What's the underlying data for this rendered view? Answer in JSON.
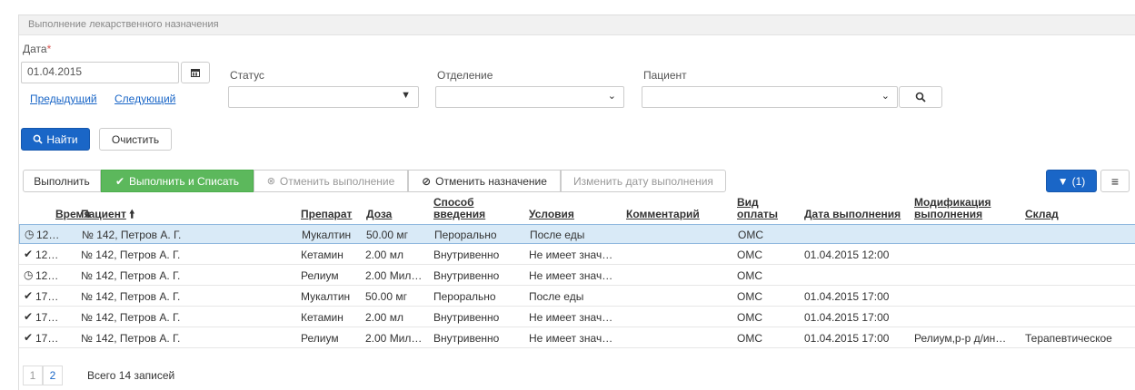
{
  "panel": {
    "title": "Выполнение лекарственного назначения"
  },
  "filters": {
    "date_label": "Дата",
    "date_required": "*",
    "date_value": "01.04.2015",
    "prev_link": "Предыдущий",
    "next_link": "Следующий",
    "status_label": "Статус",
    "status_value": "",
    "department_label": "Отделение",
    "department_value": "",
    "patient_label": "Пациент",
    "patient_value": ""
  },
  "actions": {
    "find": "Найти",
    "clear": "Очистить"
  },
  "toolbar": {
    "execute": "Выполнить",
    "execute_writeoff": "Выполнить и Списать",
    "cancel_execution": "Отменить выполнение",
    "cancel_prescription": "Отменить назначение",
    "change_date": "Изменить дату выполнения",
    "filter_count": "(1)"
  },
  "table": {
    "headers": {
      "time": "Время",
      "patient": "Пациент",
      "drug": "Препарат",
      "dose": "Доза",
      "route_1": "Способ",
      "route_2": "введения",
      "conditions": "Условия",
      "comment": "Комментарий",
      "payment_1": "Вид",
      "payment_2": "оплаты",
      "exec_date": "Дата выполнения",
      "modification_1": "Модификация",
      "modification_2": "выполнения",
      "warehouse": "Склад"
    },
    "rows": [
      {
        "status": "clock",
        "time": "12…",
        "patient": "№ 142, Петров А. Г.",
        "drug": "Мукалтин",
        "dose": "50.00 мг",
        "route": "Перорально",
        "conditions": "После еды",
        "comment": "",
        "payment": "ОМС",
        "exec_date": "",
        "modification": "",
        "warehouse": ""
      },
      {
        "status": "check",
        "time": "12…",
        "patient": "№ 142, Петров А. Г.",
        "drug": "Кетамин",
        "dose": "2.00 мл",
        "route": "Внутривенно",
        "conditions": "Не имеет знач…",
        "comment": "",
        "payment": "ОМС",
        "exec_date": "01.04.2015 12:00",
        "modification": "",
        "warehouse": ""
      },
      {
        "status": "clock",
        "time": "12…",
        "patient": "№ 142, Петров А. Г.",
        "drug": "Релиум",
        "dose": "2.00 Мил…",
        "route": "Внутривенно",
        "conditions": "Не имеет знач…",
        "comment": "",
        "payment": "ОМС",
        "exec_date": "",
        "modification": "",
        "warehouse": ""
      },
      {
        "status": "check",
        "time": "17…",
        "patient": "№ 142, Петров А. Г.",
        "drug": "Мукалтин",
        "dose": "50.00 мг",
        "route": "Перорально",
        "conditions": "После еды",
        "comment": "",
        "payment": "ОМС",
        "exec_date": "01.04.2015 17:00",
        "modification": "",
        "warehouse": ""
      },
      {
        "status": "check",
        "time": "17…",
        "patient": "№ 142, Петров А. Г.",
        "drug": "Кетамин",
        "dose": "2.00 мл",
        "route": "Внутривенно",
        "conditions": "Не имеет знач…",
        "comment": "",
        "payment": "ОМС",
        "exec_date": "01.04.2015 17:00",
        "modification": "",
        "warehouse": ""
      },
      {
        "status": "check",
        "time": "17…",
        "patient": "№ 142, Петров А. Г.",
        "drug": "Релиум",
        "dose": "2.00 Мил…",
        "route": "Внутривенно",
        "conditions": "Не имеет знач…",
        "comment": "",
        "payment": "ОМС",
        "exec_date": "01.04.2015 17:00",
        "modification": "Релиум,р-р д/ин…",
        "warehouse": "Терапевтическое"
      }
    ]
  },
  "pagination": {
    "page1": "1",
    "page2": "2",
    "total": "Всего 14 записей"
  },
  "colors": {
    "primary": "#1a66c7",
    "success": "#5cb85c",
    "selected_row": "#d9eaf7"
  }
}
